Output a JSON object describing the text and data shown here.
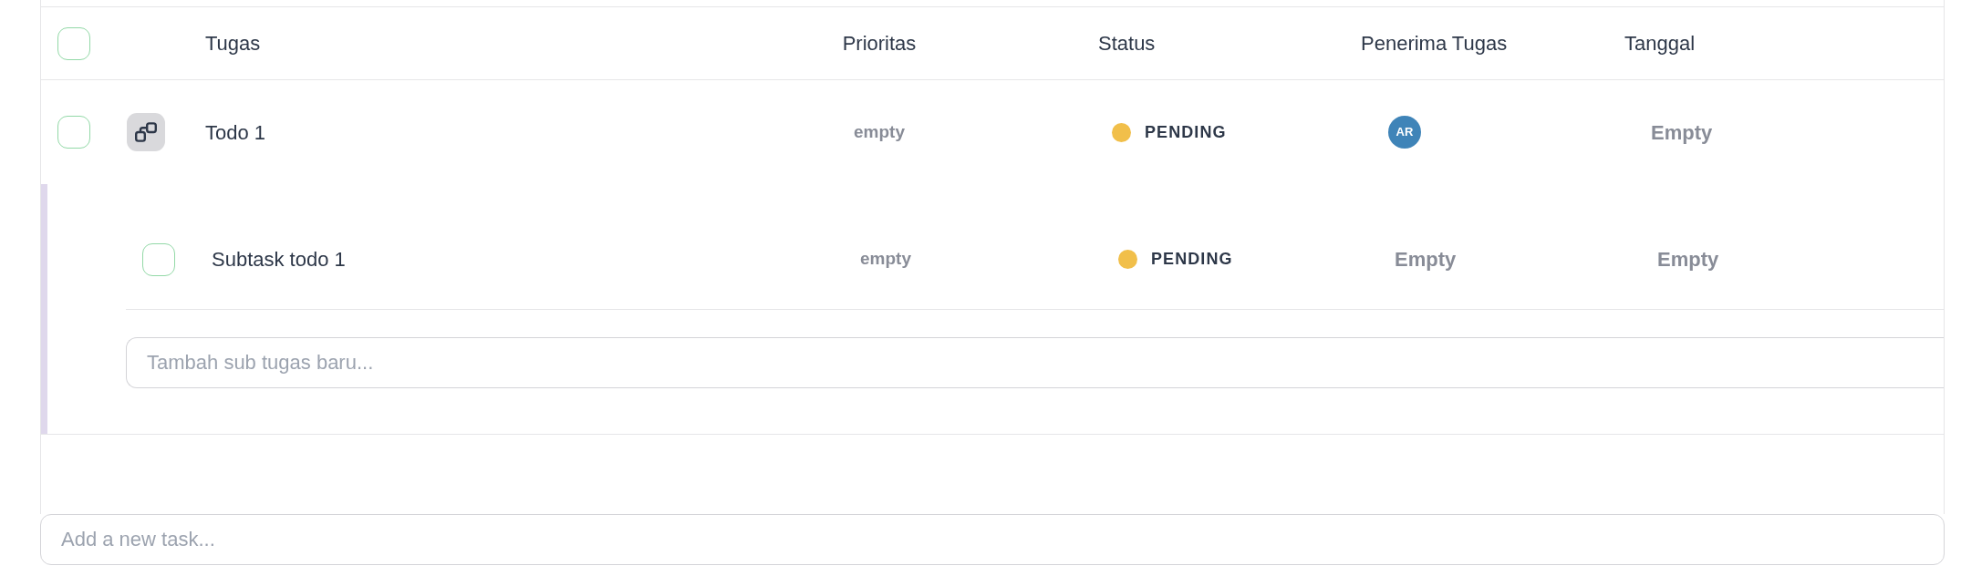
{
  "table": {
    "header_checkbox": {
      "checked": false
    },
    "columns": [
      "Tugas",
      "Prioritas",
      "Status",
      "Penerima Tugas",
      "Tanggal"
    ],
    "tasks": [
      {
        "checked": false,
        "expanded": true,
        "title": "Todo 1",
        "priority": "empty",
        "status": {
          "label": "PENDING",
          "color": "#f1bf4a"
        },
        "assignee": {
          "kind": "avatar",
          "initials": "AR"
        },
        "date": "Empty",
        "subtasks": [
          {
            "checked": false,
            "title": "Subtask todo 1",
            "priority": "empty",
            "status": {
              "label": "PENDING",
              "color": "#f1bf4a"
            },
            "assignee": {
              "kind": "text",
              "text": "Empty"
            },
            "date": "Empty"
          }
        ],
        "subtask_input": {
          "placeholder": "Tambah sub tugas baru..."
        }
      }
    ]
  },
  "new_task_input": {
    "placeholder": "Add a new task..."
  }
}
